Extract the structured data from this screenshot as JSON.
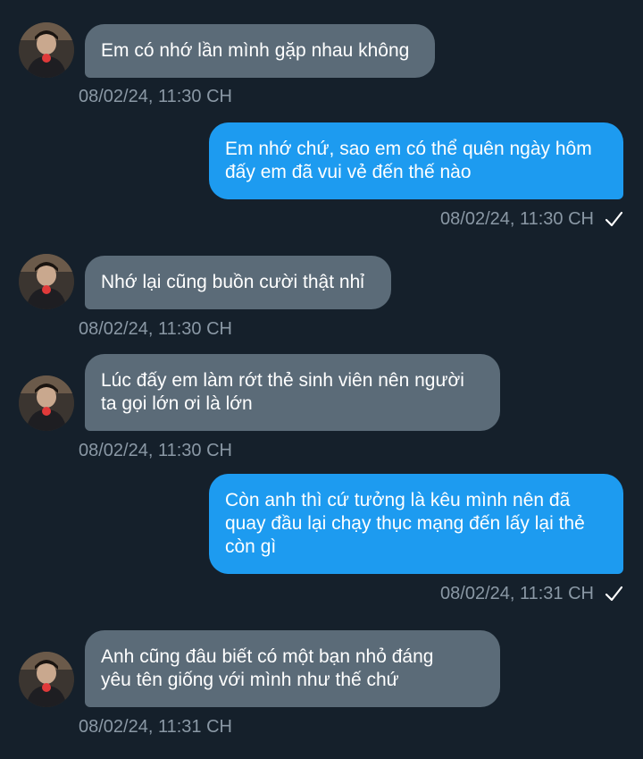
{
  "messages": [
    {
      "direction": "in",
      "text": "Em có nhớ lần mình gặp nhau không",
      "time": "08/02/24, 11:30 CH"
    },
    {
      "direction": "out",
      "text": "Em nhớ chứ, sao em có thể quên ngày hôm\nđấy em đã vui vẻ đến thế nào",
      "time": "08/02/24, 11:30 CH",
      "status_icon": "check-icon"
    },
    {
      "direction": "in",
      "text": "Nhớ lại cũng buồn cười thật nhỉ",
      "time": "08/02/24, 11:30 CH"
    },
    {
      "direction": "in",
      "text": "Lúc đấy em làm rớt thẻ sinh viên nên người\nta gọi lớn ơi là lớn",
      "time": "08/02/24, 11:30 CH"
    },
    {
      "direction": "out",
      "text": "Còn anh thì cứ tưởng là kêu mình nên đã\nquay đầu lại chạy thục mạng đến lấy lại thẻ\ncòn gì",
      "time": "08/02/24, 11:31 CH",
      "status_icon": "check-icon"
    },
    {
      "direction": "in",
      "text": "Anh cũng đâu biết có một bạn nhỏ đáng\nyêu tên giống với mình như thế chứ",
      "time": "08/02/24, 11:31 CH"
    }
  ],
  "colors": {
    "background": "#15202b",
    "incoming_bubble": "#5b6b78",
    "outgoing_bubble": "#1d9bf0",
    "timestamp": "#8a98a5"
  }
}
